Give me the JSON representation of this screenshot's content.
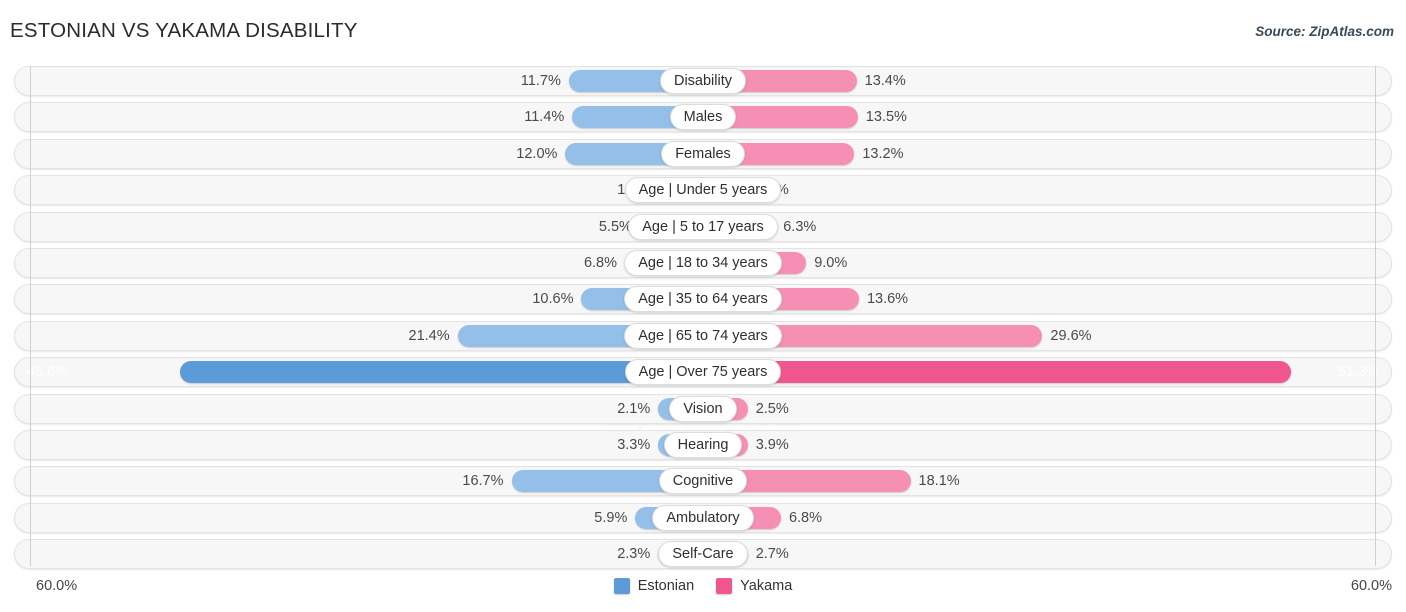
{
  "header": {
    "title": "ESTONIAN VS YAKAMA DISABILITY",
    "source": "Source: ZipAtlas.com"
  },
  "watermark": "ZipAtlas.com",
  "axis": {
    "left_label": "60.0%",
    "right_label": "60.0%",
    "max": 60.0
  },
  "legend": {
    "items": [
      {
        "label": "Estonian",
        "color": "#5b9bd8"
      },
      {
        "label": "Yakama",
        "color": "#f0578f"
      }
    ]
  },
  "colors": {
    "left_bar": "#93bfe8",
    "right_bar": "#f590b4",
    "left_bar_highlight": "#5b9bd8",
    "right_bar_highlight": "#f0578f",
    "row_track": "#f7f7f7"
  },
  "chart_data": {
    "type": "bar",
    "orientation": "horizontal-diverging",
    "title": "ESTONIAN VS YAKAMA DISABILITY",
    "xlabel": "",
    "ylabel": "",
    "xlim": [
      60.0,
      60.0
    ],
    "grid": false,
    "legend_position": "bottom-center",
    "categories": [
      "Disability",
      "Males",
      "Females",
      "Age | Under 5 years",
      "Age | 5 to 17 years",
      "Age | 18 to 34 years",
      "Age | 35 to 64 years",
      "Age | 65 to 74 years",
      "Age | Over 75 years",
      "Vision",
      "Hearing",
      "Cognitive",
      "Ambulatory",
      "Self-Care"
    ],
    "series": [
      {
        "name": "Estonian",
        "color": "#5b9bd8",
        "values": [
          11.7,
          11.4,
          12.0,
          1.5,
          5.5,
          6.8,
          10.6,
          21.4,
          45.6,
          2.1,
          3.3,
          16.7,
          5.9,
          2.3
        ],
        "labels": [
          "11.7%",
          "11.4%",
          "12.0%",
          "1.5%",
          "5.5%",
          "6.8%",
          "10.6%",
          "21.4%",
          "45.6%",
          "2.1%",
          "3.3%",
          "16.7%",
          "5.9%",
          "2.3%"
        ]
      },
      {
        "name": "Yakama",
        "color": "#f0578f",
        "values": [
          13.4,
          13.5,
          13.2,
          1.0,
          6.3,
          9.0,
          13.6,
          29.6,
          51.3,
          2.5,
          3.9,
          18.1,
          6.8,
          2.7
        ],
        "labels": [
          "13.4%",
          "13.5%",
          "13.2%",
          "1.0%",
          "6.3%",
          "9.0%",
          "13.6%",
          "29.6%",
          "51.3%",
          "2.5%",
          "3.9%",
          "18.1%",
          "6.8%",
          "2.7%"
        ]
      }
    ],
    "highlighted_rows": [
      8
    ]
  }
}
